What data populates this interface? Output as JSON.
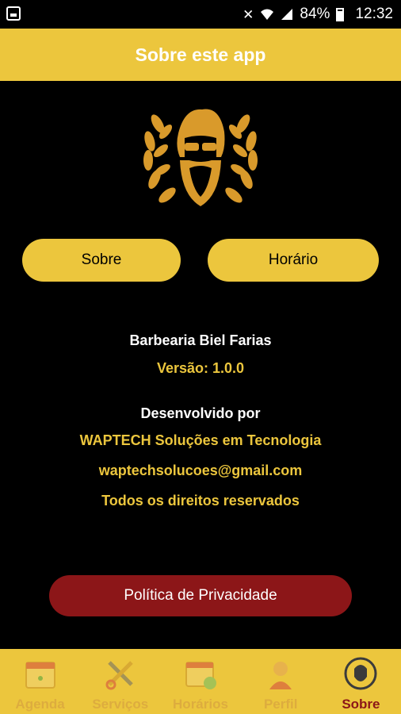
{
  "status_bar": {
    "battery": "84%",
    "time": "12:32"
  },
  "header": {
    "title": "Sobre este app"
  },
  "tabs": {
    "sobre_label": "Sobre",
    "horario_label": "Horário"
  },
  "info": {
    "business_name": "Barbearia Biel Farias",
    "version": "Versão: 1.0.0",
    "developed_by": "Desenvolvido por",
    "company": "WAPTECH Soluções em Tecnologia",
    "email": "waptechsolucoes@gmail.com",
    "rights": "Todos os direitos reservados"
  },
  "privacy_button": "Política de Privacidade",
  "bottom_nav": {
    "items": [
      {
        "label": "Agenda",
        "icon": "calendar-icon"
      },
      {
        "label": "Serviços",
        "icon": "scissors-razor-icon"
      },
      {
        "label": "Horários",
        "icon": "schedule-icon"
      },
      {
        "label": "Perfil",
        "icon": "profile-icon"
      },
      {
        "label": "Sobre",
        "icon": "barber-logo-icon"
      }
    ],
    "active_index": 4
  },
  "colors": {
    "accent": "#ecc63d",
    "privacy_button": "#8c1618",
    "background": "#000000"
  }
}
